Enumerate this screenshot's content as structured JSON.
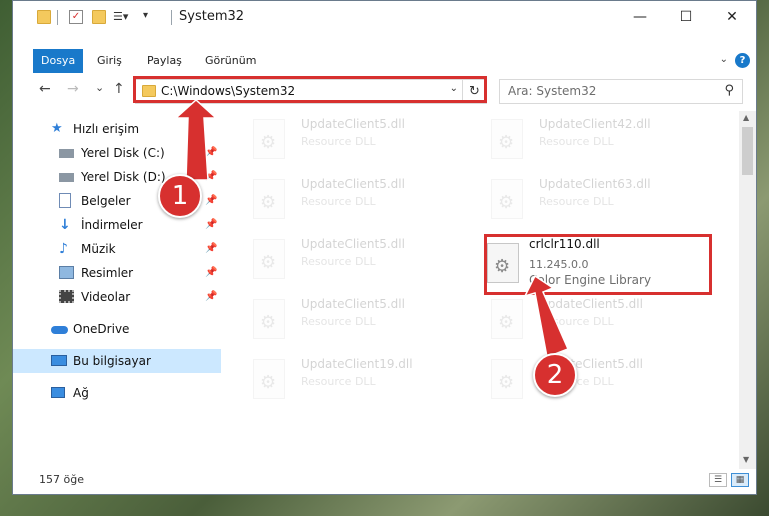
{
  "window": {
    "title": "System32",
    "controls": {
      "minimize": "—",
      "maximize": "☐",
      "close": "✕"
    }
  },
  "ribbon": {
    "tabs": [
      {
        "label": "Dosya",
        "active": true
      },
      {
        "label": "Giriş",
        "active": false
      },
      {
        "label": "Paylaş",
        "active": false
      },
      {
        "label": "Görünüm",
        "active": false
      }
    ],
    "help": "?"
  },
  "nav": {
    "back": "←",
    "forward": "→",
    "recent": "⌄",
    "up": "↑",
    "address": "C:\\Windows\\System32",
    "search_placeholder": "Ara: System32"
  },
  "sidebar": {
    "items": [
      {
        "label": "Hızlı erişim",
        "icon": "star-icon",
        "pinned": false
      },
      {
        "label": "Yerel Disk (C:)",
        "icon": "drive-c-icon",
        "pinned": true
      },
      {
        "label": "Yerel Disk (D:)",
        "icon": "drive-d-icon",
        "pinned": true
      },
      {
        "label": "Belgeler",
        "icon": "documents-icon",
        "pinned": true
      },
      {
        "label": "İndirmeler",
        "icon": "downloads-icon",
        "pinned": true
      },
      {
        "label": "Müzik",
        "icon": "music-icon",
        "pinned": true
      },
      {
        "label": "Resimler",
        "icon": "pictures-icon",
        "pinned": true
      },
      {
        "label": "Videolar",
        "icon": "videos-icon",
        "pinned": true
      },
      {
        "label": "OneDrive",
        "icon": "cloud-icon",
        "pinned": false
      },
      {
        "label": "Bu bilgisayar",
        "icon": "computer-icon",
        "pinned": false,
        "selected": true
      },
      {
        "label": "Ağ",
        "icon": "network-icon",
        "pinned": false
      }
    ]
  },
  "files": [
    {
      "name": "UpdateClient5.dll",
      "sub": "Resource DLL",
      "faded": true
    },
    {
      "name": "UpdateClient42.dll",
      "sub": "Resource DLL",
      "faded": true
    },
    {
      "name": "UpdateClient5.dll",
      "sub": "Resource DLL",
      "faded": true
    },
    {
      "name": "UpdateClient63.dll",
      "sub": "Resource DLL",
      "faded": true
    },
    {
      "name": "UpdateClient5.dll",
      "sub": "Resource DLL",
      "faded": true
    },
    {
      "name": "crlclr110.dll",
      "sub": "11.245.0.0",
      "sub2": "Color Engine Library",
      "faded": false
    },
    {
      "name": "UpdateClient5.dll",
      "sub": "Resource DLL",
      "faded": true
    },
    {
      "name": "UpdateClient5.dll",
      "sub": "Resource DLL",
      "faded": true
    },
    {
      "name": "UpdateClient19.dll",
      "sub": "Resource DLL",
      "faded": true
    },
    {
      "name": "UpdateClient5.dll",
      "sub": "Resource DLL",
      "faded": true
    }
  ],
  "status": {
    "count": "157 öğe"
  },
  "annotations": {
    "badge1": "1",
    "badge2": "2"
  },
  "colors": {
    "accent": "#1979ca",
    "annotation": "#d7302f",
    "selected": "#cce8ff"
  }
}
